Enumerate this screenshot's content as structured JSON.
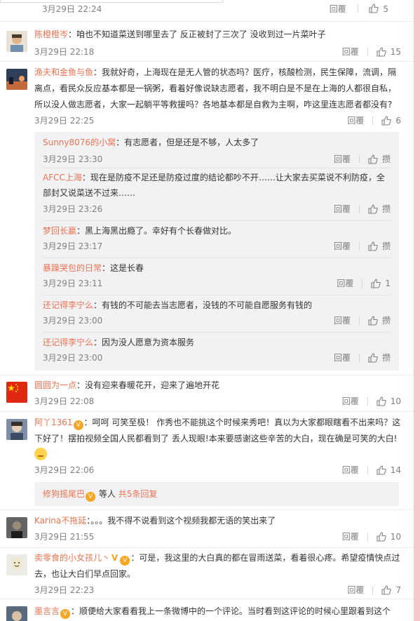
{
  "top_partial": {
    "time": "3月29日 22:24",
    "reply": "回覆",
    "likes": "5"
  },
  "comments": [
    {
      "user": "陈橙橙岑",
      "text": "：咱也不知道菜送到哪里去了 反正被封了三次了 没收到过一片菜叶子",
      "time": "3月29日 22:18",
      "reply": "回覆",
      "likes": "15"
    },
    {
      "user": "渔夫和金鱼与鱼",
      "text": "：我就好奇，上海现在是无人管的状态吗？医疗，核酸检测，民生保障，流调，隔离点，看民众反应基本都是一锅粥，看着好像说缺志愿者，我不明白是不是在上海的人都很自私，所以没人做志愿者，大家一起躺平等救援吗？各地基本都是自救为主啊，咋这里连志愿者都没有?",
      "time": "3月29日 22:25",
      "reply": "回覆",
      "likes": "6",
      "replies": [
        {
          "user": "Sunny8076的小窝",
          "text": "：有志愿者，但是还是不够，人太多了",
          "time": "3月29日 23:30",
          "reply": "回覆",
          "like": "攒"
        },
        {
          "user": "AFCC上海",
          "text": "：现在是防疫不足还是防疫过度的结论都吵不开……让大家去买菜说不利防疫，全部封又说菜送不过来……",
          "time": "3月29日 23:26",
          "reply": "回覆",
          "like": "攒"
        },
        {
          "user": "梦回长嬴",
          "text": "：黑上海黑出瘾了。幸好有个长春做对比。",
          "time": "3月29日 23:17",
          "reply": "回覆",
          "like": "攒"
        },
        {
          "user": "暴躁哭包的日常",
          "text": "：这是长春",
          "time": "3月29日 23:11",
          "reply": "回覆",
          "like": "1"
        },
        {
          "user": "还记得李宁么",
          "text": "：有钱的不可能去当志愿者，没钱的不可能自愿服务有钱的",
          "time": "3月29日 23:00",
          "reply": "回覆",
          "like": "攒"
        },
        {
          "user": "还记得李宁么",
          "text": "：因为没人愿意为资本服务",
          "time": "3月29日 23:00",
          "reply": "回覆",
          "like": "攒"
        }
      ]
    },
    {
      "user": "圆圆为一点",
      "text": "：没有迎来春暖花开，迎来了遍地开花",
      "time": "3月29日 22:08",
      "reply": "回覆",
      "likes": "10"
    },
    {
      "user": "阿丫1361",
      "text": "：呵呵 可笑至极！ 作秀也不能挑这个时候来秀吧！真以为大家都眼瞎看不出来吗？这下好了！摆拍视频全国人民都看到了 丢人现眼!本来要感谢这些辛苦的大白，现在确是可笑的大白!",
      "time": "3月29日 22:06",
      "reply": "回覆",
      "likes": "14",
      "more": {
        "user": "修狗摇尾巴",
        "mid": "等人",
        "count": "共5条回复"
      }
    },
    {
      "user": "Karina不拖延",
      "text": "：。。。我不得不说看到这个视频我都无语的笑出来了",
      "time": "3月29日 21:55",
      "reply": "回覆",
      "likes": "10"
    },
    {
      "user": "卖零食的小女孩儿丶",
      "text": "：可是，我这里的大白真的都在冒雨送菜，看着很心疼。希望疫情快点过去，也让大白们早点回家。",
      "time": "3月29日 22:23",
      "reply": "回覆",
      "likes": "7"
    },
    {
      "user": "墨言言",
      "text": "：顺便给大家看看我上一条微博中的一个评论。当时看到这评论的时候心里跟着到这个"
    }
  ],
  "colors": {
    "username": "#eb7350",
    "text": "#333333",
    "meta": "#808080",
    "reply_bg": "#f2f2f5",
    "accent_strip": "#f7c7cc"
  },
  "icons": {
    "like": "thumbs-up-icon",
    "badge": "member-badge-icon"
  }
}
